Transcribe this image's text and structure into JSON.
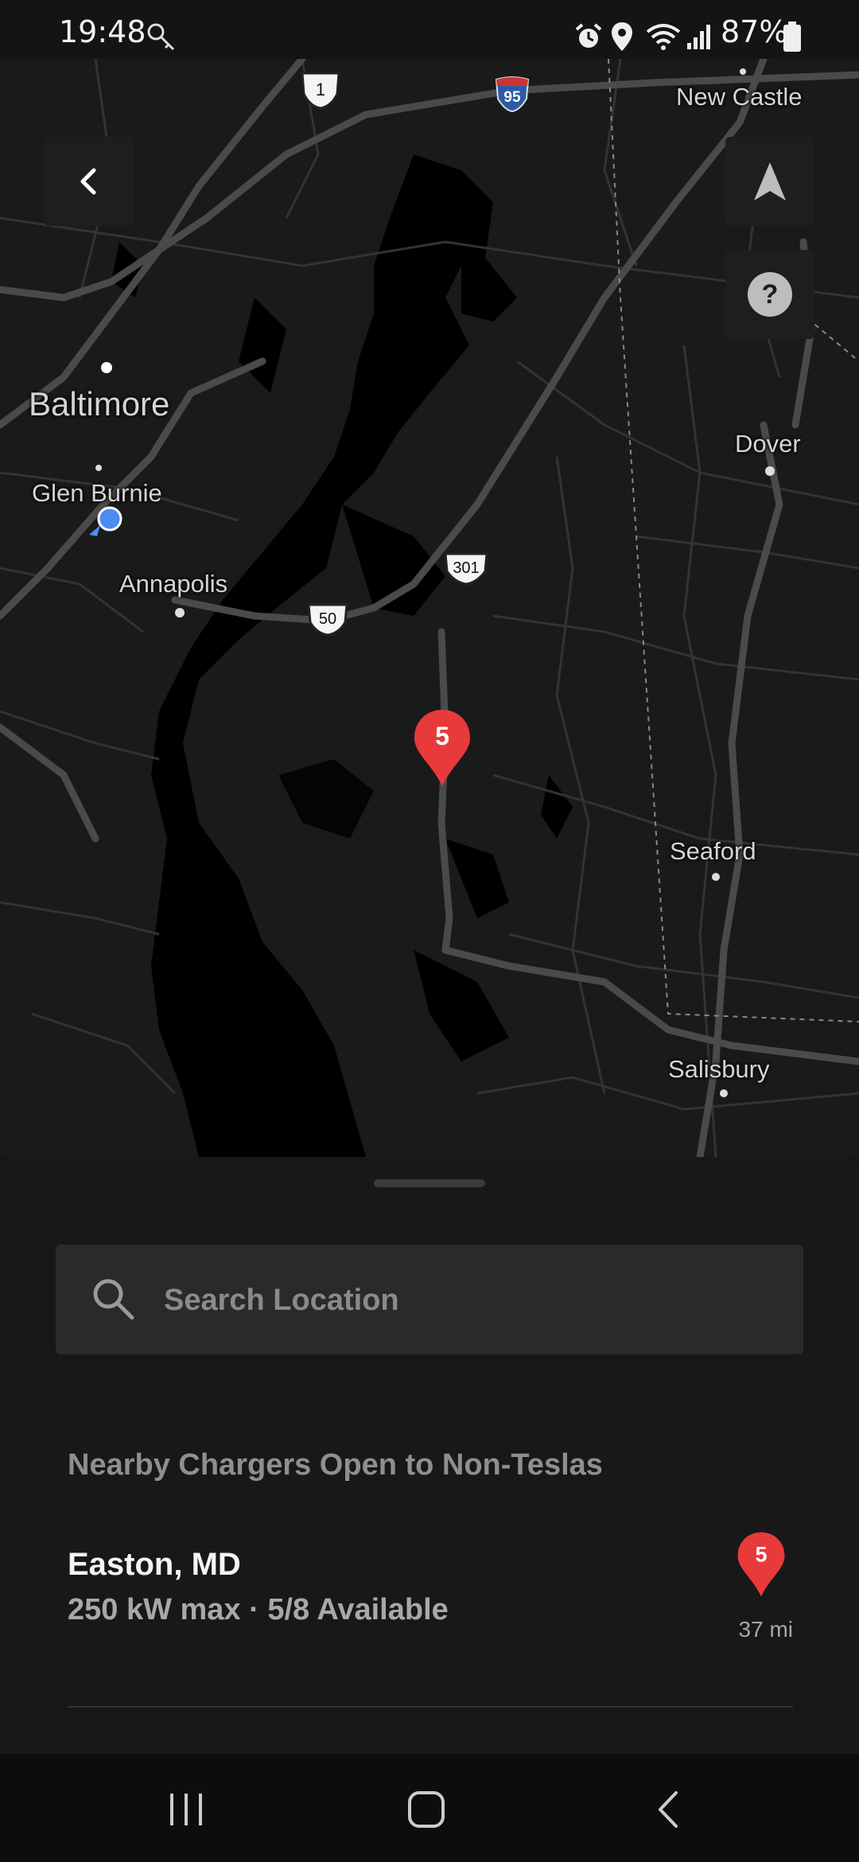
{
  "status_bar": {
    "time": "19:48",
    "battery": "87%",
    "icons": [
      "key-icon",
      "alarm-icon",
      "location-icon",
      "wifi-icon",
      "signal-icon",
      "battery-icon"
    ]
  },
  "map": {
    "labels": {
      "new_castle": "New Castle",
      "baltimore": "Baltimore",
      "glen_burnie": "Glen Burnie",
      "annapolis": "Annapolis",
      "dover": "Dover",
      "seaford": "Seaford",
      "salisbury": "Salisbury"
    },
    "shields": {
      "us1": "1",
      "i95": "95",
      "us301": "301",
      "us50": "50"
    },
    "pin_count": "5",
    "buttons": [
      "back-icon",
      "navigate-arrow-icon",
      "help-icon"
    ],
    "help_glyph": "?"
  },
  "sheet": {
    "search_placeholder": "Search Location",
    "section_title": "Nearby Chargers Open to Non-Teslas",
    "charger": {
      "city": "Easton, MD",
      "details": "250 kW max · 5/8 Available",
      "pin_count": "5",
      "distance": "37 mi"
    }
  },
  "colors": {
    "pin_red": "#e83a3a",
    "location_dot": "#4a8cf0",
    "map_bg": "#1a1a1a",
    "water": "#000000"
  }
}
